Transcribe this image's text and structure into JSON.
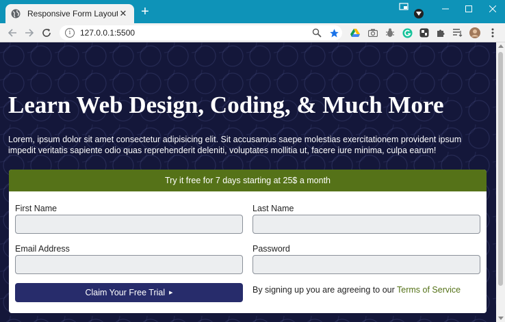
{
  "browser": {
    "tab_title": "Responsive Form Layout",
    "tab_close": "✕",
    "new_tab": "+",
    "url": "127.0.0.1:5500"
  },
  "hero": {
    "title": "Learn Web Design, Coding, & Much More",
    "text": "Lorem, ipsum dolor sit amet consectetur adipisicing elit. Sit accusamus saepe molestias exercitationem provident ipsum impedit veritatis sapiente odio quas reprehenderit deleniti, voluptates mollitia ut, facere iure minima, culpa earum!"
  },
  "form": {
    "header": "Try it free for 7 days starting at 25$ a month",
    "fields": {
      "first_name": {
        "label": "First Name",
        "value": ""
      },
      "last_name": {
        "label": "Last Name",
        "value": ""
      },
      "email": {
        "label": "Email Address",
        "value": ""
      },
      "password": {
        "label": "Password",
        "value": ""
      }
    },
    "submit_label": "Claim Your Free Trial",
    "submit_arrow": "▶",
    "terms_text": "By signing up you are agreeing to our ",
    "terms_link": "Terms of Service"
  },
  "colors": {
    "accent_green": "#557218",
    "button_navy": "#272c6b",
    "page_background": "#14173a",
    "browser_frame": "#0e93b8"
  },
  "icons": [
    "globe-icon",
    "back-arrow-icon",
    "forward-arrow-icon",
    "reload-icon",
    "site-info-icon",
    "zoom-icon",
    "bookmark-star-icon",
    "drive-icon",
    "camera-icon",
    "bug-icon",
    "grammarly-icon",
    "extension-icon",
    "puzzle-icon",
    "media-icon",
    "profile-avatar-icon",
    "menu-kebab-icon",
    "minimize-icon",
    "maximize-icon",
    "close-window-icon"
  ]
}
